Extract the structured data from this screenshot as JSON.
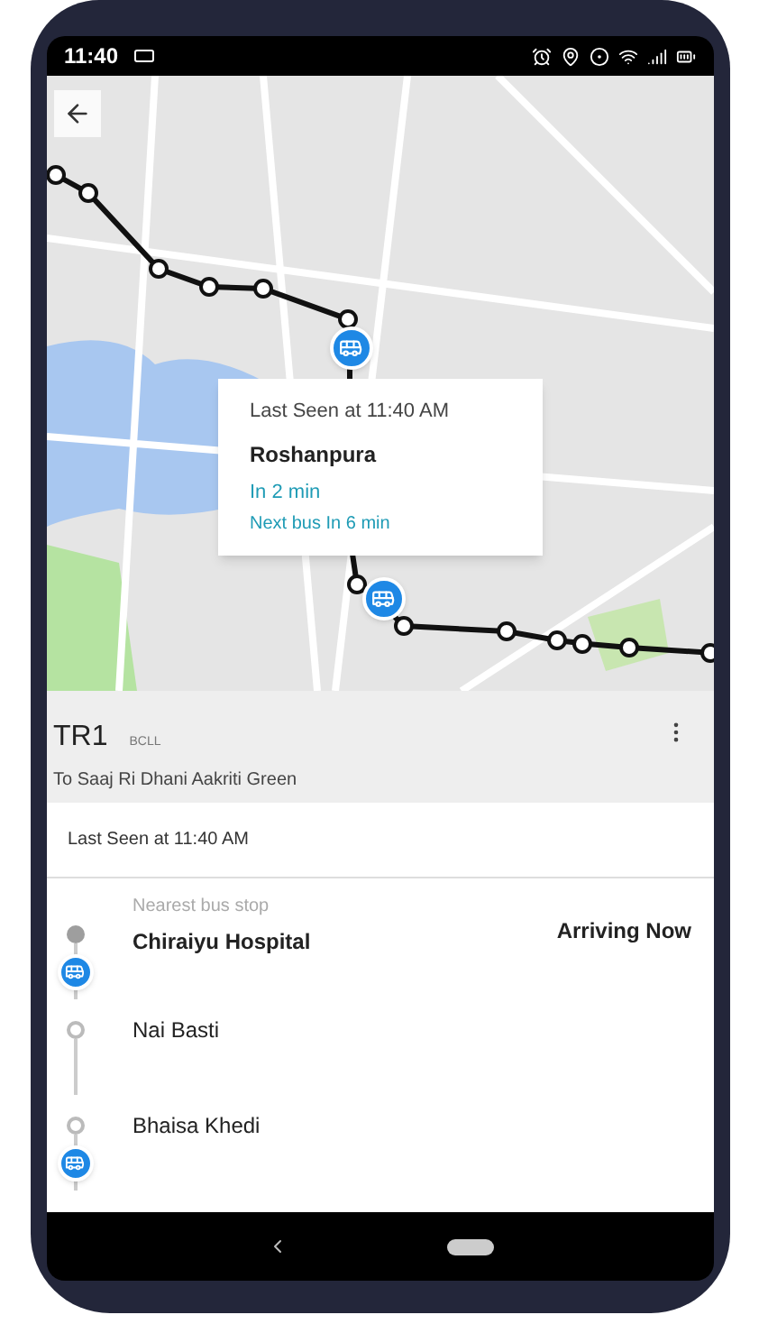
{
  "status_bar": {
    "time": "11:40"
  },
  "map_popup": {
    "last_seen": "Last Seen at 11:40 AM",
    "stop": "Roshanpura",
    "eta": "In 2 min",
    "next_bus": "Next bus In 6 min"
  },
  "route": {
    "name": "TR1",
    "operator": "BCLL",
    "destination": "To Saaj Ri Dhani Aakriti Green"
  },
  "last_seen": "Last Seen at 11:40 AM",
  "stops": [
    {
      "label": "Nearest bus stop",
      "name": "Chiraiyu Hospital",
      "status": "Arriving Now",
      "passed": true,
      "bus_below": true
    },
    {
      "name": "Nai Basti",
      "passed": false,
      "bus_below": false
    },
    {
      "name": "Bhaisa Khedi",
      "passed": false,
      "bus_below": true
    }
  ]
}
